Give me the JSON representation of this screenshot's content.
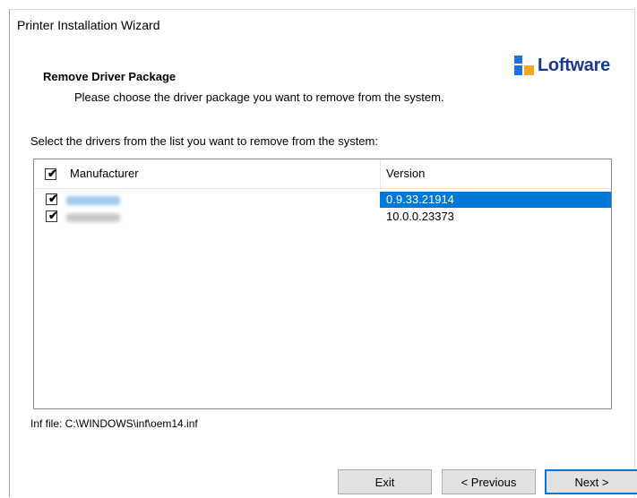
{
  "window": {
    "title": "Printer Installation Wizard"
  },
  "header": {
    "title": "Remove Driver Package",
    "description": "Please choose the driver package you want to remove from the system."
  },
  "logo": {
    "text": "Loftware",
    "trademark": "."
  },
  "content": {
    "instruction": "Select the drivers from the list you want to remove from the system:",
    "list": {
      "header_checked": true,
      "columns": [
        "Manufacturer",
        "Version"
      ],
      "rows": [
        {
          "checked": true,
          "version": "0.9.33.21914",
          "selected": true
        },
        {
          "checked": true,
          "version": "10.0.0.23373",
          "selected": false
        }
      ]
    },
    "inf_file": "Inf file: C:\\WINDOWS\\inf\\oem14.inf"
  },
  "buttons": {
    "exit": "Exit",
    "previous": "< Previous",
    "next": "Next >"
  },
  "colors": {
    "selection": "#0078d7",
    "logo_blue": "#1e73d8",
    "logo_orange": "#f5a623"
  },
  "icons": {
    "checkbox": "check-icon"
  }
}
